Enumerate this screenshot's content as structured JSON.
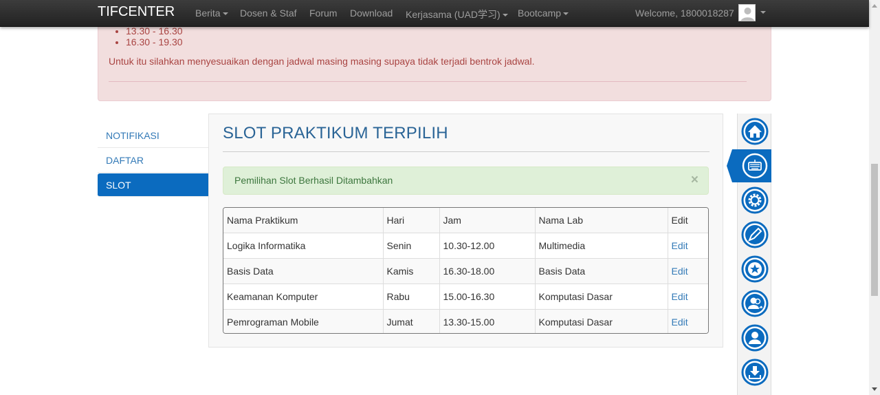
{
  "navbar": {
    "brand": "TIFCENTER",
    "items": [
      {
        "label": "Berita",
        "dropdown": true
      },
      {
        "label": "Dosen & Staf",
        "dropdown": false
      },
      {
        "label": "Forum",
        "dropdown": false
      },
      {
        "label": "Download",
        "dropdown": false
      },
      {
        "label": "Kerjasama (UAD学习)",
        "dropdown": true
      },
      {
        "label": "Bootcamp",
        "dropdown": true
      }
    ],
    "welcome": "Welcome, 1800018287"
  },
  "alert": {
    "times": [
      "13.30 - 16.30",
      "16.30 - 19.30"
    ],
    "message": "Untuk itu silahkan menyesuaikan dengan jadwal masing masing supaya tidak terjadi bentrok jadwal."
  },
  "sidebar": {
    "items": [
      {
        "label": "NOTIFIKASI",
        "active": false
      },
      {
        "label": "DAFTAR",
        "active": false
      },
      {
        "label": "SLOT",
        "active": true
      }
    ]
  },
  "main": {
    "title": "SLOT PRAKTIKUM TERPILIH",
    "success_message": "Pemilihan Slot Berhasil Ditambahkan",
    "close_symbol": "×",
    "table": {
      "headers": [
        "Nama Praktikum",
        "Hari",
        "Jam",
        "Nama Lab",
        "Edit"
      ],
      "rows": [
        {
          "praktikum": "Logika Informatika",
          "hari": "Senin",
          "jam": "10.30-12.00",
          "lab": "Multimedia",
          "edit": "Edit"
        },
        {
          "praktikum": "Basis Data",
          "hari": "Kamis",
          "jam": "16.30-18.00",
          "lab": "Basis Data",
          "edit": "Edit"
        },
        {
          "praktikum": "Keamanan Komputer",
          "hari": "Rabu",
          "jam": "15.00-16.30",
          "lab": "Komputasi Dasar",
          "edit": "Edit"
        },
        {
          "praktikum": "Pemrograman Mobile",
          "hari": "Jumat",
          "jam": "13.30-15.00",
          "lab": "Komputasi Dasar",
          "edit": "Edit"
        }
      ]
    }
  },
  "icon_bar": {
    "icons": [
      "home-icon",
      "keyboard-icon",
      "gear-icon",
      "pen-icon",
      "star-icon",
      "users-icon",
      "user-icon",
      "download-icon"
    ],
    "active_index": 1
  },
  "colors": {
    "accent": "#0b6bbf",
    "link": "#337ab7",
    "danger_text": "#a94442",
    "success_text": "#3c763d"
  }
}
